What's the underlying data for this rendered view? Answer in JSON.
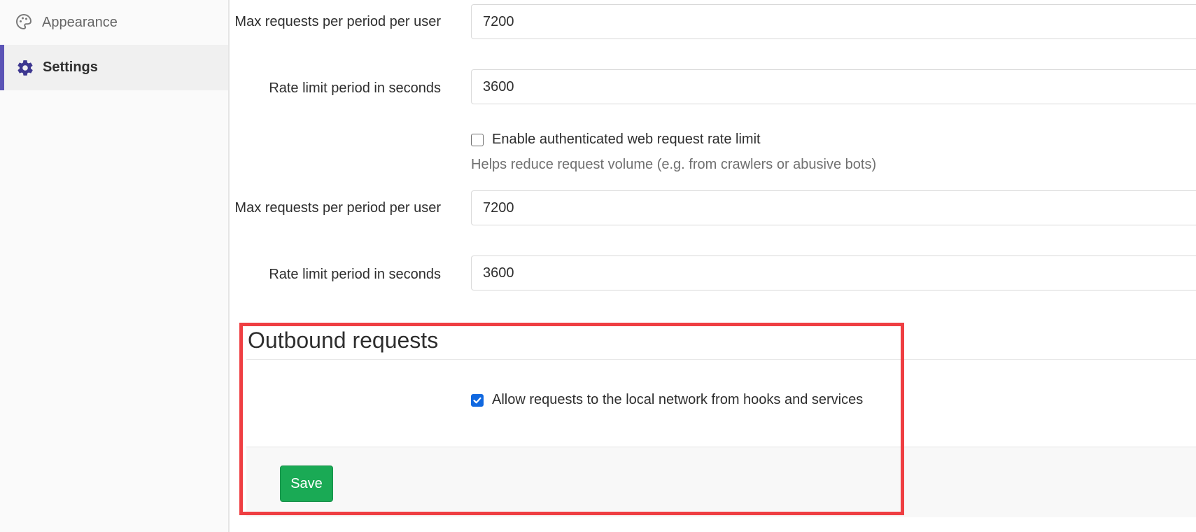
{
  "sidebar": {
    "items": [
      {
        "label": "Appearance",
        "icon": "palette-icon"
      },
      {
        "label": "Settings",
        "icon": "gear-icon"
      }
    ],
    "active": "Settings",
    "accent_color": "#5b54b6"
  },
  "rate_limit_1": {
    "max_requests_label": "Max requests per period per user",
    "max_requests_value": "7200",
    "period_label": "Rate limit period in seconds",
    "period_value": "3600"
  },
  "web_rate_limit": {
    "checkbox_label": "Enable authenticated web request rate limit",
    "checked": false,
    "help_text": "Helps reduce request volume (e.g. from crawlers or abusive bots)",
    "max_requests_label": "Max requests per period per user",
    "max_requests_value": "7200",
    "period_label": "Rate limit period in seconds",
    "period_value": "3600"
  },
  "outbound": {
    "title": "Outbound requests",
    "checkbox_label": "Allow requests to the local network from hooks and services",
    "checked": true
  },
  "footer": {
    "save_label": "Save",
    "save_color": "#1aaa55"
  },
  "highlight_color": "#ef3e42"
}
